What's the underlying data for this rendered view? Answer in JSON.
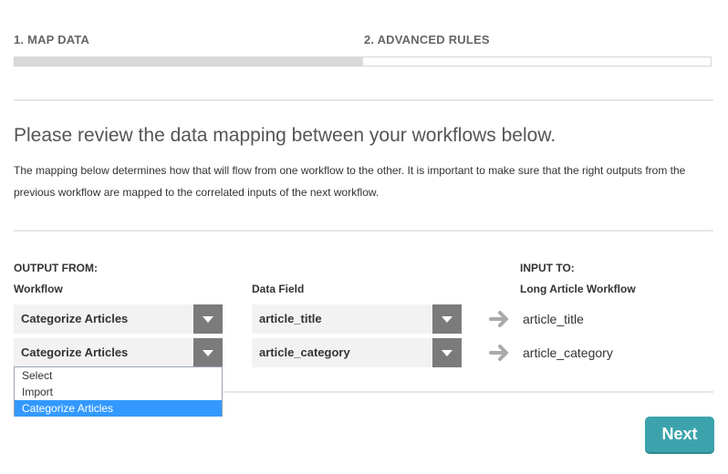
{
  "steps": [
    {
      "label": "1. MAP DATA"
    },
    {
      "label": "2. ADVANCED RULES"
    }
  ],
  "progress": {
    "fraction": 0.5
  },
  "heading": "Please review the data mapping between your workflows below.",
  "description": "The mapping below determines how that will flow from one workflow to the other. It is important to make sure that the right outputs from the previous workflow are mapped to the correlated inputs of the next workflow.",
  "mapping": {
    "output_from_label": "OUTPUT FROM:",
    "workflow_label": "Workflow",
    "data_field_label": "Data Field",
    "input_to_label": "INPUT TO:",
    "target_workflow": "Long Article Workflow",
    "rows": [
      {
        "workflow": "Categorize Articles",
        "data_field": "article_title",
        "input": "article_title"
      },
      {
        "workflow": "Categorize Articles",
        "data_field": "article_category",
        "input": "article_category"
      }
    ]
  },
  "dropdown": {
    "options": [
      "Select",
      "Import",
      "Categorize Articles"
    ],
    "selected_index": 2
  },
  "next_button": "Next",
  "colors": {
    "accent": "#3ca3ad",
    "selected_option": "#3399ff",
    "select_button": "#7b7b7b"
  }
}
